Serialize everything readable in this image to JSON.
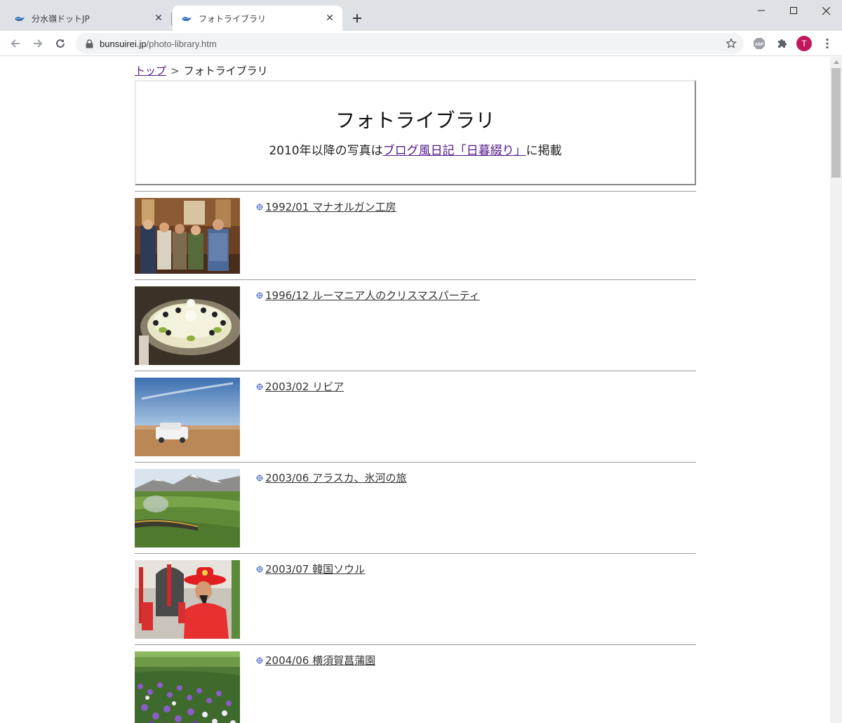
{
  "browser": {
    "tabs": [
      {
        "title": "分水嶺ドットJP",
        "active": false
      },
      {
        "title": "フォトライブラリ",
        "active": true
      }
    ],
    "url_host": "bunsuirei.jp",
    "url_path": "/photo-library.htm",
    "profile_initial": "T",
    "extension_abp": "ABP"
  },
  "page": {
    "breadcrumb": {
      "home": "トップ",
      "separator": ">",
      "current": "フォトライブラリ"
    },
    "title": "フォトライブラリ",
    "subtitle_prefix": "2010年以降の写真は",
    "subtitle_link": "ブログ風日記「日暮綴り」",
    "subtitle_suffix": "に掲載",
    "entries": [
      {
        "label": "1992/01 マナオルガン工房",
        "photo": "group-photo"
      },
      {
        "label": "1996/12 ルーマニア人のクリスマスパーティ",
        "photo": "cake-photo"
      },
      {
        "label": "2003/02 リビア",
        "photo": "desert-photo"
      },
      {
        "label": "2003/06 アラスカ、氷河の旅",
        "photo": "alaska-train-photo"
      },
      {
        "label": "2003/07 韓国ソウル",
        "photo": "seoul-guard-photo"
      },
      {
        "label": "2004/06 横須賀菖蒲園",
        "photo": "iris-garden-photo"
      }
    ]
  },
  "colors": {
    "tabstrip": "#dee1e6",
    "visited_link": "#551a8b",
    "avatar": "#c2185b"
  }
}
